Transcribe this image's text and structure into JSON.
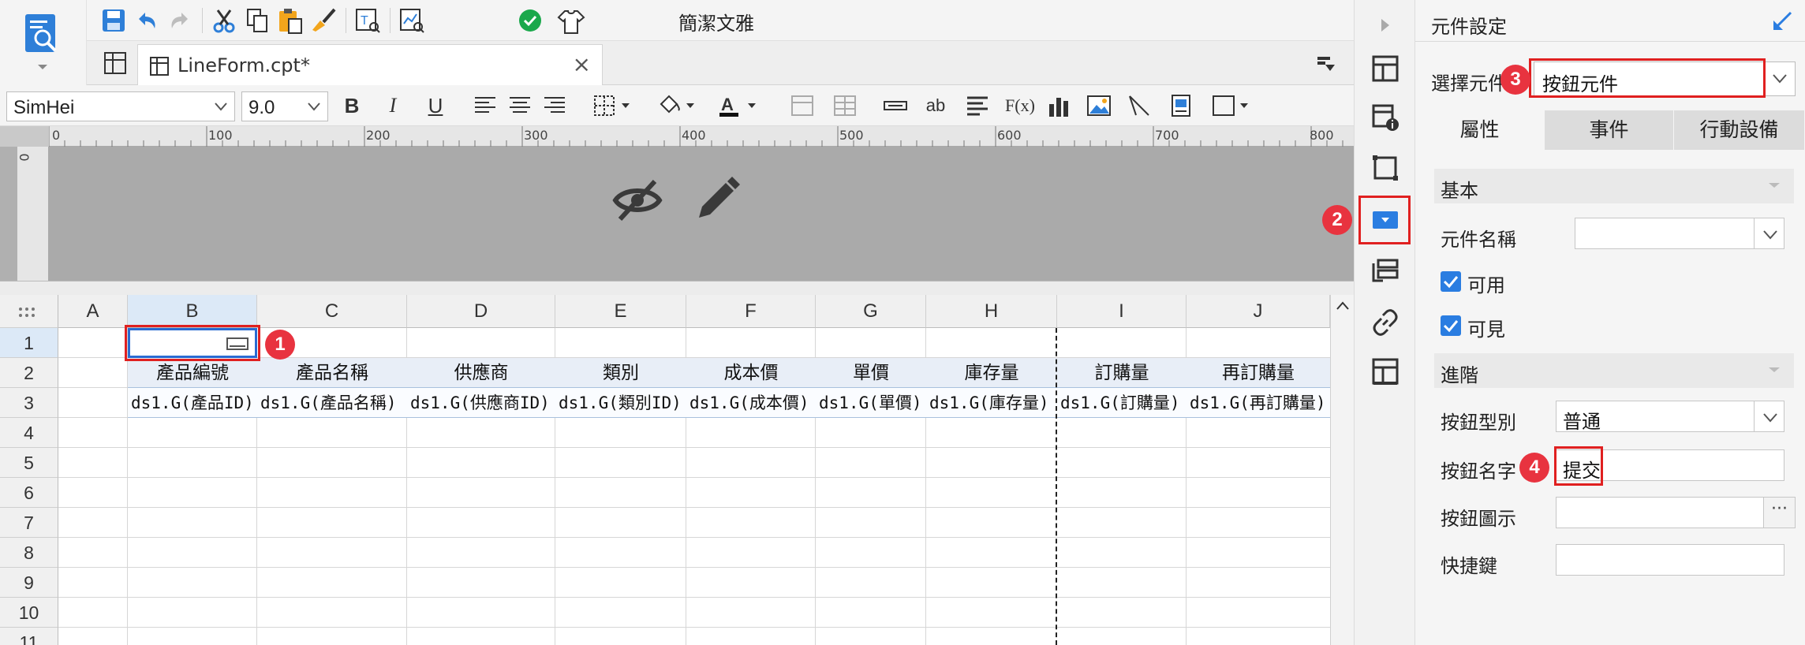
{
  "toolbar": {
    "simplify_label": "簡潔文雅"
  },
  "tab": {
    "file_name": "LineForm.cpt*",
    "close_glyph": "×"
  },
  "format_bar": {
    "font_family": "SimHei",
    "font_size": "9.0",
    "bold": "B",
    "italic": "I",
    "underline": "U",
    "formula": "F(x)",
    "ab": "ab"
  },
  "ruler": {
    "ticks": [
      "0",
      "100",
      "200",
      "300",
      "400",
      "500",
      "600",
      "700",
      "800"
    ],
    "vertical_zero": "0"
  },
  "sheet": {
    "columns": [
      "A",
      "B",
      "C",
      "D",
      "E",
      "F",
      "G",
      "H",
      "I",
      "J"
    ],
    "selected_column": "B",
    "rows": [
      "1",
      "2",
      "3",
      "4",
      "5",
      "6",
      "7",
      "8",
      "9",
      "10",
      "11"
    ],
    "header_row": [
      "產品編號",
      "產品名稱",
      "供應商",
      "類別",
      "成本價",
      "單價",
      "庫存量",
      "訂購量",
      "再訂購量"
    ],
    "data_row": [
      "ds1.G(產品ID)",
      "ds1.G(產品名稱)",
      "ds1.G(供應商ID)",
      "ds1.G(類別ID)",
      "ds1.G(成本價)",
      "ds1.G(單價)",
      "ds1.G(庫存量)",
      "ds1.G(訂購量)",
      "ds1.G(再訂購量)"
    ]
  },
  "markers": [
    "1",
    "2",
    "3",
    "4"
  ],
  "panel": {
    "title": "元件設定",
    "select_label": "選擇元件",
    "select_value": "按鈕元件",
    "tabs": [
      "屬性",
      "事件",
      "行動設備"
    ],
    "section_basic": "基本",
    "widget_name_label": "元件名稱",
    "widget_name_value": "",
    "enabled_label": "可用",
    "visible_label": "可見",
    "section_advanced": "進階",
    "button_type_label": "按鈕型別",
    "button_type_value": "普通",
    "button_name_label": "按鈕名字",
    "button_name_value": "提交",
    "button_icon_label": "按鈕圖示",
    "button_icon_more": "···",
    "shortcut_label": "快捷鍵"
  },
  "colors": {
    "accent_blue": "#2a7de1",
    "highlight_red": "#e02020",
    "marker_red": "#e8333f"
  }
}
